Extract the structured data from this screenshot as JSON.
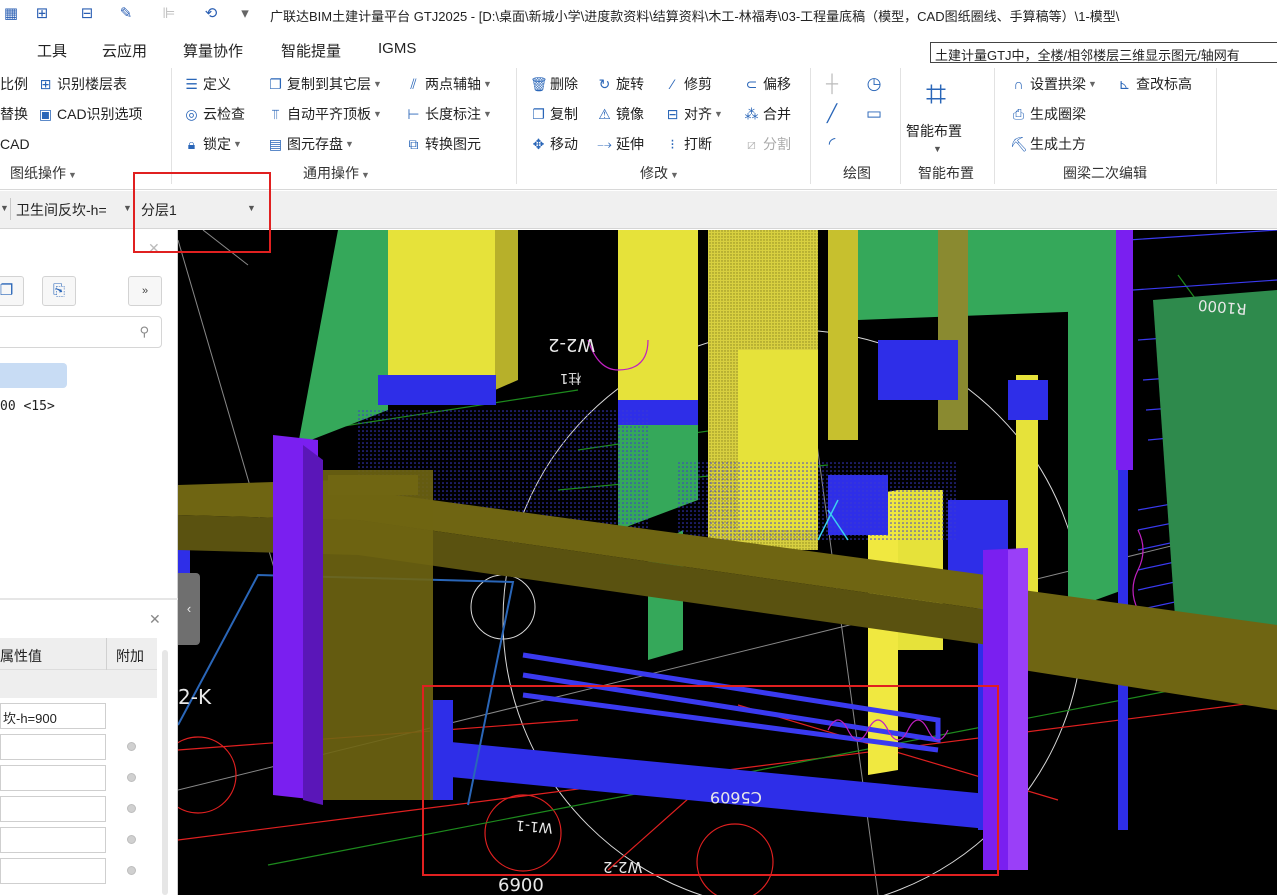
{
  "title": {
    "app_title": "广联达BIM土建计量平台 GTJ2025 - [D:\\桌面\\新城小学\\进度款资料\\结算资料\\木工-林福寿\\03-工程量底稿（模型，CAD图纸圈线、手算稿等）\\1-模型\\"
  },
  "menu": {
    "items": [
      "工具",
      "云应用",
      "算量协作",
      "智能提量",
      "IGMS"
    ],
    "help_search": "土建计量GTJ中，全楼/相邻楼层三维显示图元/轴网有"
  },
  "ribbon": {
    "drawing_ops": {
      "items": [
        "比例",
        "识别楼层表",
        "替换",
        "CAD识别选项",
        "CAD"
      ],
      "label": "图纸操作"
    },
    "general_ops": {
      "items": [
        "定义",
        "复制到其它层",
        "两点辅轴",
        "云检查",
        "自动平齐顶板",
        "长度标注",
        "锁定",
        "图元存盘",
        "转换图元"
      ],
      "label": "通用操作"
    },
    "modify": {
      "items": [
        "删除",
        "旋转",
        "修剪",
        "偏移",
        "复制",
        "镜像",
        "对齐",
        "合并",
        "移动",
        "延伸",
        "打断",
        "分割"
      ],
      "label": "修改"
    },
    "draw": {
      "label": "绘图"
    },
    "smart_layout": {
      "button": "智能布置",
      "label": "智能布置"
    },
    "ring_beam": {
      "items": [
        "设置拱梁",
        "查改标高",
        "生成圈梁",
        "生成土方"
      ],
      "label": "圈梁二次编辑"
    }
  },
  "selector_bar": {
    "component": "卫生间反坎-h=",
    "layer": "分层1"
  },
  "left_panel": {
    "list_item": "00 <15>",
    "properties": {
      "col_value": "属性值",
      "col_extra": "附加",
      "name_value": "坎-h=900"
    }
  },
  "viewport": {
    "labels": {
      "w2_top": "W2-2",
      "zhu_top": "柱1",
      "r1000": "R1000",
      "k_label": "2-K",
      "c5609": "C5609",
      "w2_bottom": "W2-2",
      "w1": "W1-1",
      "d6900": "6900"
    }
  },
  "colors": {
    "wall_blue": "#2e2ee8",
    "column_purple": "#7a1ff0",
    "beam_olive": "#6f6512",
    "wall_yellow": "#e6e23a",
    "wall_green": "#35a85a",
    "highlight_red": "#e02020"
  }
}
